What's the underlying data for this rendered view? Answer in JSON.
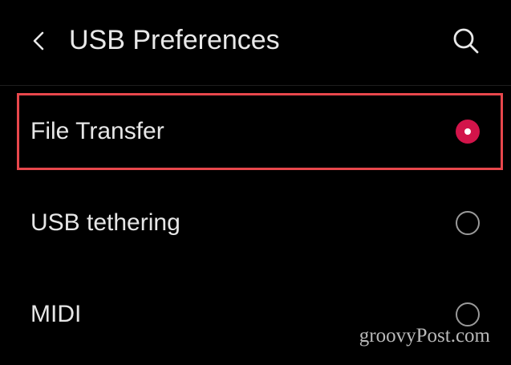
{
  "header": {
    "title": "USB Preferences",
    "back_icon": "chevron-left-icon",
    "search_icon": "search-icon"
  },
  "options": [
    {
      "label": "File Transfer",
      "selected": true
    },
    {
      "label": "USB tethering",
      "selected": false
    },
    {
      "label": "MIDI",
      "selected": false
    }
  ],
  "colors": {
    "accent": "#d2144a",
    "highlight_border": "#e8474c",
    "background": "#000000"
  },
  "watermark": "groovyPost.com"
}
